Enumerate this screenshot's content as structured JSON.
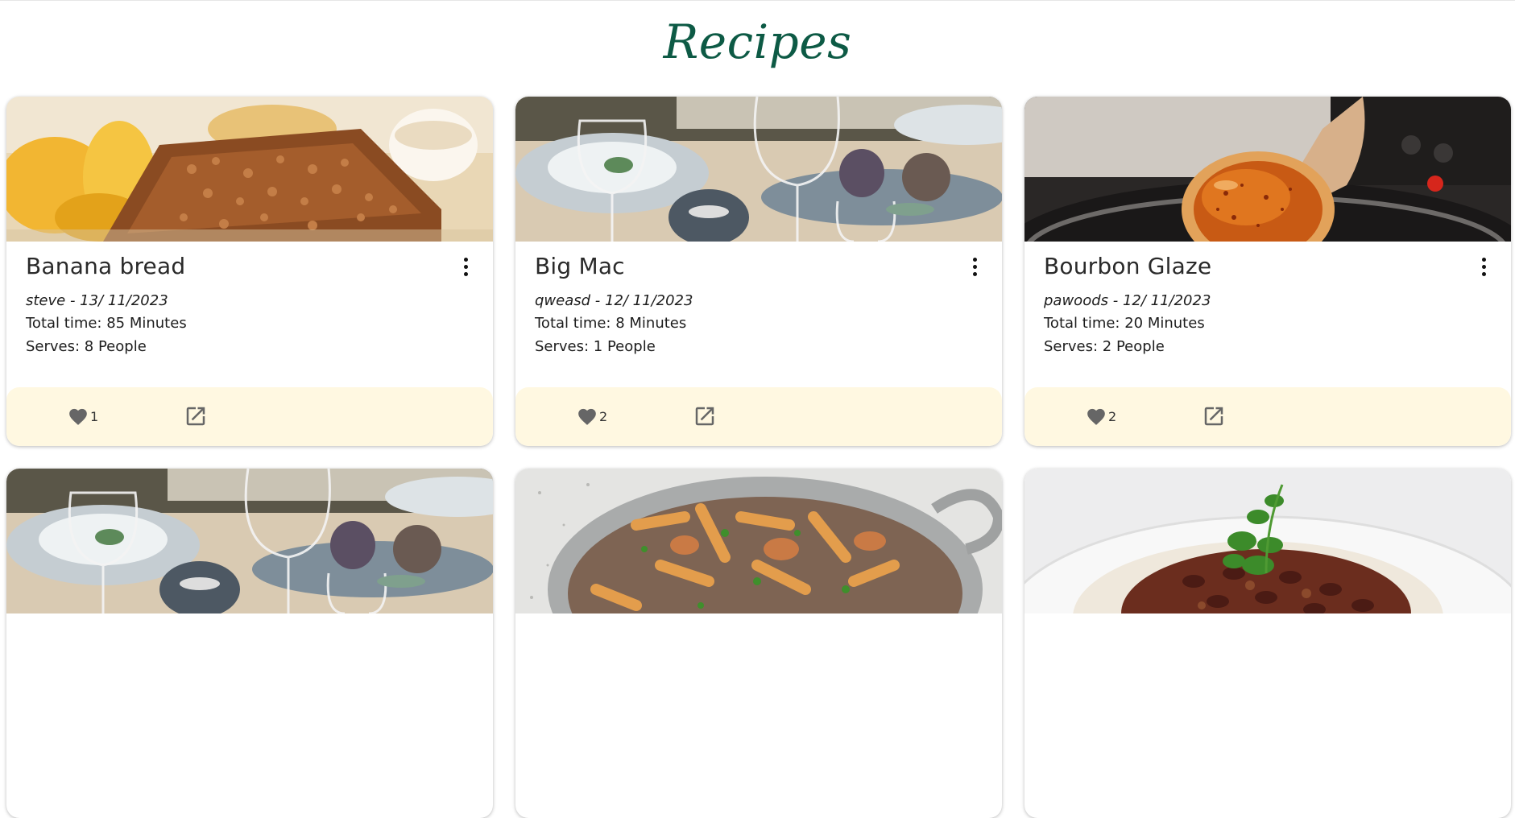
{
  "page": {
    "title": "Recipes"
  },
  "colors": {
    "title": "#0d5a45",
    "card_footer": "#fff8e1",
    "icon": "#666666"
  },
  "icons": {
    "like": "heart-icon",
    "open": "open-in-new-icon",
    "menu": "more-vert-icon"
  },
  "recipes": [
    {
      "title": "Banana bread",
      "meta": "steve - 13/ 11/2023",
      "total_time": "Total time: 85 Minutes",
      "serves": "Serves: 8 People",
      "likes": "1",
      "image": "banana-bread"
    },
    {
      "title": "Big Mac",
      "meta": "qweasd - 12/ 11/2023",
      "total_time": "Total time: 8 Minutes",
      "serves": "Serves: 1 People",
      "likes": "2",
      "image": "table-setting"
    },
    {
      "title": "Bourbon Glaze",
      "meta": "pawoods - 12/ 11/2023",
      "total_time": "Total time: 20 Minutes",
      "serves": "Serves: 2 People",
      "likes": "2",
      "image": "glaze-spoon"
    },
    {
      "image": "table-setting"
    },
    {
      "image": "pasta-pan"
    },
    {
      "image": "chili-rice"
    }
  ]
}
